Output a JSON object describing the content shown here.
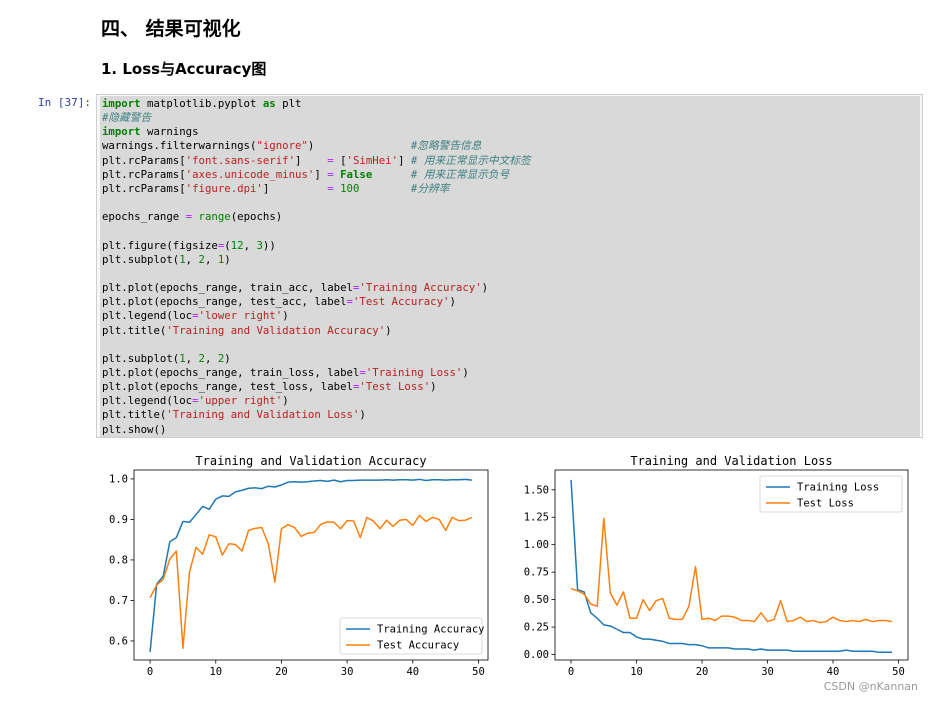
{
  "section_title": "四、 结果可视化",
  "subsection_title": "1. Loss与Accuracy图",
  "cell": {
    "prompt": "In [37]:",
    "lines": [
      [
        [
          "kw",
          "import"
        ],
        [
          "t",
          " matplotlib.pyplot "
        ],
        [
          "kw",
          "as"
        ],
        [
          "t",
          " plt"
        ]
      ],
      [
        [
          "cm",
          "#隐藏警告"
        ]
      ],
      [
        [
          "kw",
          "import"
        ],
        [
          "t",
          " warnings"
        ]
      ],
      [
        [
          "t",
          "warnings.filterwarnings("
        ],
        [
          "st",
          "\"ignore\""
        ],
        [
          "t",
          ")               "
        ],
        [
          "cm",
          "#忽略警告信息"
        ]
      ],
      [
        [
          "t",
          "plt.rcParams["
        ],
        [
          "st",
          "'font.sans-serif'"
        ],
        [
          "t",
          "]    "
        ],
        [
          "op",
          "="
        ],
        [
          "t",
          " ["
        ],
        [
          "st",
          "'SimHei'"
        ],
        [
          "t",
          "] "
        ],
        [
          "cm",
          "# 用来正常显示中文标签"
        ]
      ],
      [
        [
          "t",
          "plt.rcParams["
        ],
        [
          "st",
          "'axes.unicode_minus'"
        ],
        [
          "t",
          "] "
        ],
        [
          "op",
          "="
        ],
        [
          "t",
          " "
        ],
        [
          "kw",
          "False"
        ],
        [
          "t",
          "      "
        ],
        [
          "cm",
          "# 用来正常显示负号"
        ]
      ],
      [
        [
          "t",
          "plt.rcParams["
        ],
        [
          "st",
          "'figure.dpi'"
        ],
        [
          "t",
          "]         "
        ],
        [
          "op",
          "="
        ],
        [
          "t",
          " "
        ],
        [
          "nm",
          "100"
        ],
        [
          "t",
          "        "
        ],
        [
          "cm",
          "#分辨率"
        ]
      ],
      [],
      [
        [
          "t",
          "epochs_range "
        ],
        [
          "op",
          "="
        ],
        [
          "t",
          " "
        ],
        [
          "nb",
          "range"
        ],
        [
          "t",
          "(epochs)"
        ]
      ],
      [],
      [
        [
          "t",
          "plt.figure(figsize"
        ],
        [
          "op",
          "="
        ],
        [
          "t",
          "("
        ],
        [
          "nm",
          "12"
        ],
        [
          "t",
          ", "
        ],
        [
          "nm",
          "3"
        ],
        [
          "t",
          "))"
        ]
      ],
      [
        [
          "t",
          "plt.subplot("
        ],
        [
          "nm",
          "1"
        ],
        [
          "t",
          ", "
        ],
        [
          "nm",
          "2"
        ],
        [
          "t",
          ", "
        ],
        [
          "nm",
          "1"
        ],
        [
          "t",
          ")"
        ]
      ],
      [],
      [
        [
          "t",
          "plt.plot(epochs_range, train_acc, label"
        ],
        [
          "op",
          "="
        ],
        [
          "st",
          "'Training Accuracy'"
        ],
        [
          "t",
          ")"
        ]
      ],
      [
        [
          "t",
          "plt.plot(epochs_range, test_acc, label"
        ],
        [
          "op",
          "="
        ],
        [
          "st",
          "'Test Accuracy'"
        ],
        [
          "t",
          ")"
        ]
      ],
      [
        [
          "t",
          "plt.legend(loc"
        ],
        [
          "op",
          "="
        ],
        [
          "st",
          "'lower right'"
        ],
        [
          "t",
          ")"
        ]
      ],
      [
        [
          "t",
          "plt.title("
        ],
        [
          "st",
          "'Training and Validation Accuracy'"
        ],
        [
          "t",
          ")"
        ]
      ],
      [],
      [
        [
          "t",
          "plt.subplot("
        ],
        [
          "nm",
          "1"
        ],
        [
          "t",
          ", "
        ],
        [
          "nm",
          "2"
        ],
        [
          "t",
          ", "
        ],
        [
          "nm",
          "2"
        ],
        [
          "t",
          ")"
        ]
      ],
      [
        [
          "t",
          "plt.plot(epochs_range, train_loss, label"
        ],
        [
          "op",
          "="
        ],
        [
          "st",
          "'Training Loss'"
        ],
        [
          "t",
          ")"
        ]
      ],
      [
        [
          "t",
          "plt.plot(epochs_range, test_loss, label"
        ],
        [
          "op",
          "="
        ],
        [
          "st",
          "'Test Loss'"
        ],
        [
          "t",
          ")"
        ]
      ],
      [
        [
          "t",
          "plt.legend(loc"
        ],
        [
          "op",
          "="
        ],
        [
          "st",
          "'upper right'"
        ],
        [
          "t",
          ")"
        ]
      ],
      [
        [
          "t",
          "plt.title("
        ],
        [
          "st",
          "'Training and Validation Loss'"
        ],
        [
          "t",
          ")"
        ]
      ],
      [
        [
          "t",
          "plt.show()"
        ]
      ]
    ]
  },
  "colors": {
    "series_blue": "#1f77b4",
    "series_orange": "#ff7f0e"
  },
  "chart_data": [
    {
      "type": "line",
      "title": "Training and Validation Accuracy",
      "xlabel": "",
      "ylabel": "",
      "xlim": [
        -2.45,
        51.45
      ],
      "ylim": [
        0.553,
        1.022
      ],
      "xticks": [
        0,
        10,
        20,
        30,
        40,
        50
      ],
      "yticks": [
        0.6,
        0.7,
        0.8,
        0.9,
        1.0
      ],
      "ytick_labels": [
        "0.6",
        "0.7",
        "0.8",
        "0.9",
        "1.0"
      ],
      "legend": "lower right",
      "grid": false,
      "x": [
        0,
        1,
        2,
        3,
        4,
        5,
        6,
        7,
        8,
        9,
        10,
        11,
        12,
        13,
        14,
        15,
        16,
        17,
        18,
        19,
        20,
        21,
        22,
        23,
        24,
        25,
        26,
        27,
        28,
        29,
        30,
        31,
        32,
        33,
        34,
        35,
        36,
        37,
        38,
        39,
        40,
        41,
        42,
        43,
        44,
        45,
        46,
        47,
        48,
        49
      ],
      "series": [
        {
          "name": "Training Accuracy",
          "values": [
            0.573,
            0.74,
            0.76,
            0.845,
            0.855,
            0.895,
            0.893,
            0.912,
            0.932,
            0.925,
            0.95,
            0.958,
            0.957,
            0.968,
            0.972,
            0.977,
            0.978,
            0.976,
            0.982,
            0.98,
            0.985,
            0.992,
            0.993,
            0.992,
            0.993,
            0.995,
            0.996,
            0.994,
            0.997,
            0.993,
            0.996,
            0.996,
            0.997,
            0.997,
            0.997,
            0.997,
            0.998,
            0.997,
            0.998,
            0.998,
            0.997,
            0.999,
            0.996,
            0.998,
            0.998,
            0.997,
            0.998,
            0.998,
            0.999,
            0.997
          ]
        },
        {
          "name": "Test Accuracy",
          "values": [
            0.707,
            0.738,
            0.752,
            0.802,
            0.822,
            0.582,
            0.77,
            0.831,
            0.814,
            0.862,
            0.857,
            0.812,
            0.84,
            0.838,
            0.822,
            0.873,
            0.878,
            0.88,
            0.84,
            0.745,
            0.877,
            0.887,
            0.88,
            0.858,
            0.866,
            0.868,
            0.888,
            0.894,
            0.893,
            0.877,
            0.897,
            0.896,
            0.855,
            0.905,
            0.896,
            0.877,
            0.898,
            0.883,
            0.898,
            0.9,
            0.885,
            0.91,
            0.895,
            0.905,
            0.9,
            0.873,
            0.905,
            0.897,
            0.898,
            0.905
          ]
        }
      ]
    },
    {
      "type": "line",
      "title": "Training and Validation Loss",
      "xlabel": "",
      "ylabel": "",
      "xlim": [
        -2.45,
        51.45
      ],
      "ylim": [
        -0.05,
        1.68
      ],
      "xticks": [
        0,
        10,
        20,
        30,
        40,
        50
      ],
      "yticks": [
        0.0,
        0.25,
        0.5,
        0.75,
        1.0,
        1.25,
        1.5
      ],
      "ytick_labels": [
        "0.00",
        "0.25",
        "0.50",
        "0.75",
        "1.00",
        "1.25",
        "1.50"
      ],
      "legend": "upper right",
      "grid": false,
      "x": [
        0,
        1,
        2,
        3,
        4,
        5,
        6,
        7,
        8,
        9,
        10,
        11,
        12,
        13,
        14,
        15,
        16,
        17,
        18,
        19,
        20,
        21,
        22,
        23,
        24,
        25,
        26,
        27,
        28,
        29,
        30,
        31,
        32,
        33,
        34,
        35,
        36,
        37,
        38,
        39,
        40,
        41,
        42,
        43,
        44,
        45,
        46,
        47,
        48,
        49
      ],
      "series": [
        {
          "name": "Training Loss",
          "values": [
            1.59,
            0.59,
            0.57,
            0.38,
            0.33,
            0.27,
            0.26,
            0.23,
            0.2,
            0.2,
            0.16,
            0.14,
            0.14,
            0.13,
            0.12,
            0.1,
            0.1,
            0.1,
            0.09,
            0.09,
            0.08,
            0.06,
            0.06,
            0.06,
            0.06,
            0.05,
            0.05,
            0.05,
            0.04,
            0.05,
            0.04,
            0.04,
            0.04,
            0.04,
            0.03,
            0.03,
            0.03,
            0.03,
            0.03,
            0.03,
            0.03,
            0.03,
            0.04,
            0.03,
            0.03,
            0.03,
            0.03,
            0.02,
            0.02,
            0.02
          ]
        },
        {
          "name": "Test Loss",
          "values": [
            0.6,
            0.58,
            0.55,
            0.46,
            0.44,
            1.24,
            0.56,
            0.45,
            0.57,
            0.33,
            0.33,
            0.5,
            0.4,
            0.49,
            0.51,
            0.33,
            0.32,
            0.32,
            0.44,
            0.8,
            0.32,
            0.33,
            0.31,
            0.35,
            0.35,
            0.34,
            0.31,
            0.31,
            0.3,
            0.38,
            0.3,
            0.32,
            0.49,
            0.3,
            0.31,
            0.34,
            0.3,
            0.31,
            0.29,
            0.3,
            0.34,
            0.31,
            0.3,
            0.31,
            0.3,
            0.32,
            0.3,
            0.31,
            0.31,
            0.3
          ]
        }
      ]
    }
  ],
  "watermark": "CSDN @nKannan"
}
